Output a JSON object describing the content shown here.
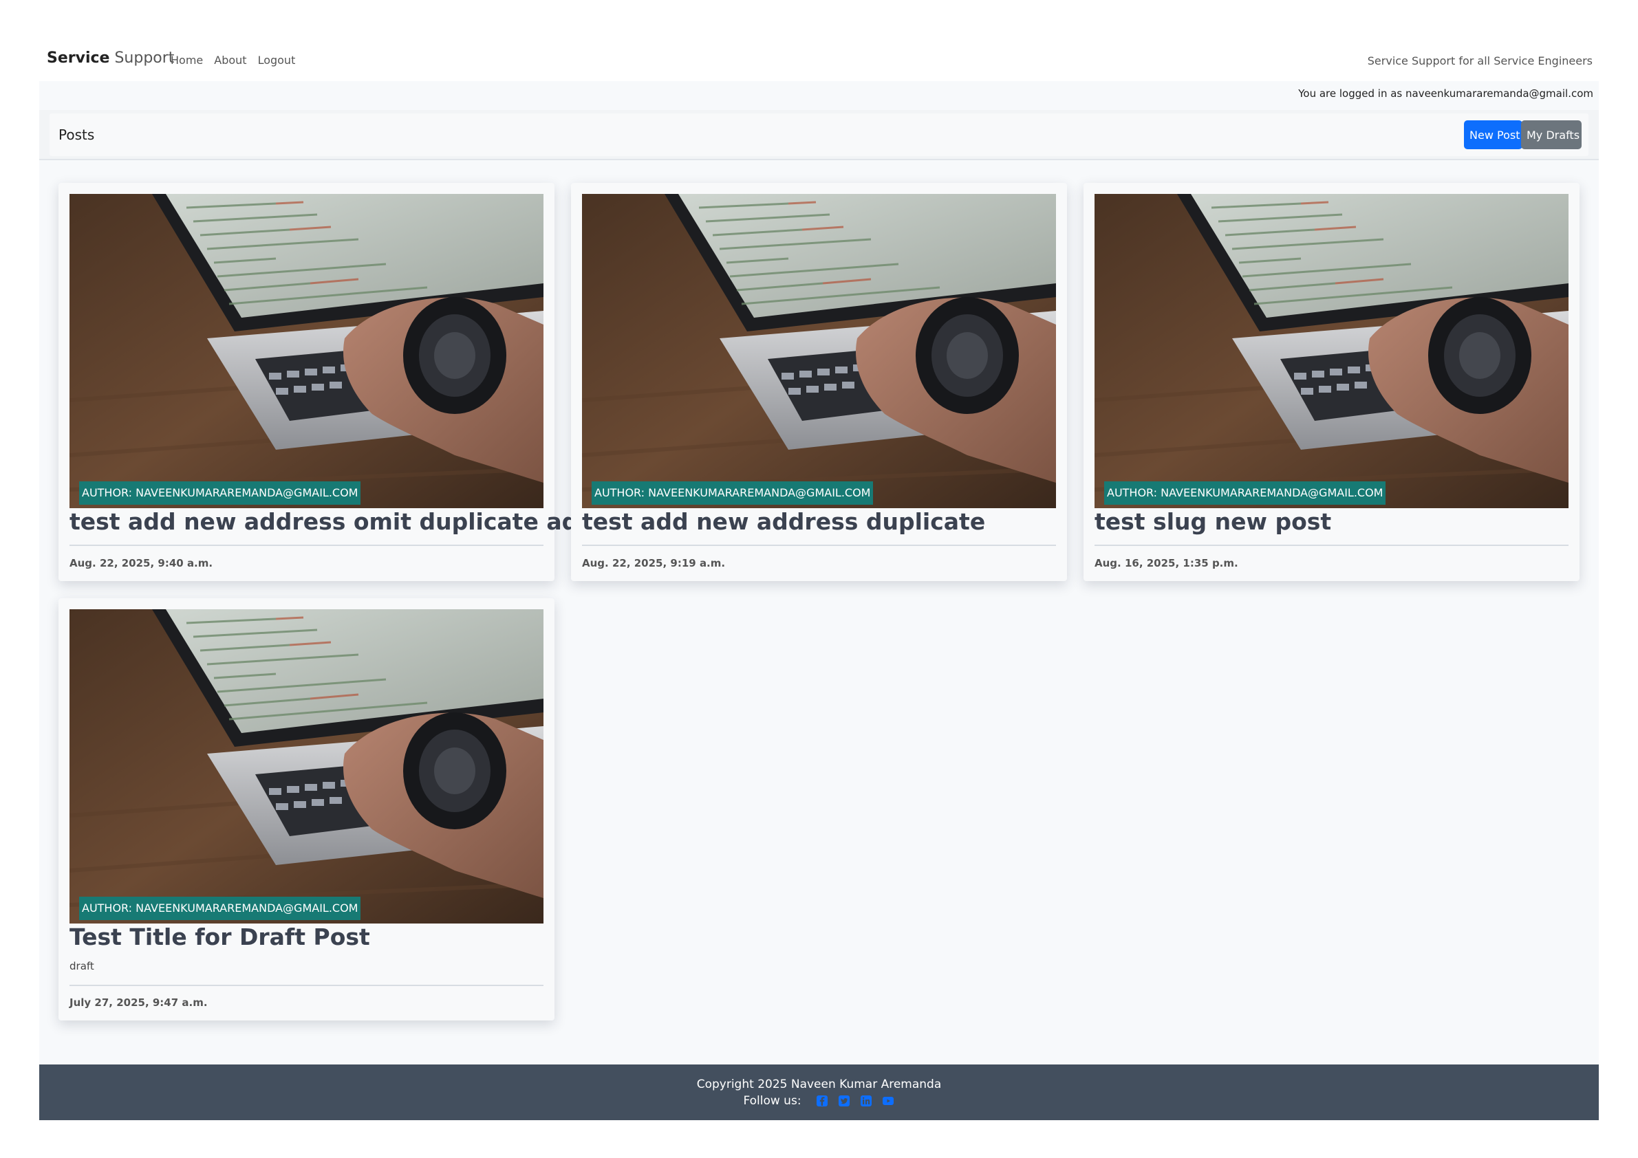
{
  "navbar": {
    "brand_bold": "Service",
    "brand_light": "Support",
    "links": [
      "Home",
      "About",
      "Logout"
    ],
    "tagline": "Service Support for all Service Engineers"
  },
  "session": {
    "logged_in_text": "You are logged in as naveenkumararemanda@gmail.com"
  },
  "posts_header": {
    "title": "Posts",
    "new_post_label": "New Post",
    "my_drafts_label": "My Drafts"
  },
  "posts": [
    {
      "author": "AUTHOR: NAVEENKUMARAREMANDA@GMAIL.COM",
      "title": "test add new address omit duplicate address",
      "status": "",
      "date": "Aug. 22, 2025, 9:40 a.m."
    },
    {
      "author": "AUTHOR: NAVEENKUMARAREMANDA@GMAIL.COM",
      "title": "test add new address duplicate",
      "status": "",
      "date": "Aug. 22, 2025, 9:19 a.m."
    },
    {
      "author": "AUTHOR: NAVEENKUMARAREMANDA@GMAIL.COM",
      "title": "test slug new post",
      "status": "",
      "date": "Aug. 16, 2025, 1:35 p.m."
    },
    {
      "author": "AUTHOR: NAVEENKUMARAREMANDA@GMAIL.COM",
      "title": "Test Title for Draft Post",
      "status": "draft",
      "date": "July 27, 2025, 9:47 a.m."
    }
  ],
  "footer": {
    "copyright": "Copyright 2025 Naveen Kumar Aremanda",
    "follow_label": "Follow us:",
    "social_icons": [
      "facebook-icon",
      "twitter-icon",
      "linkedin-icon",
      "youtube-icon"
    ]
  },
  "colors": {
    "primary": "#0d6efd",
    "secondary": "#6c757d",
    "author_badge": "#177a74",
    "footer_bg": "#434f5e",
    "page_bg": "#f7f9fb",
    "social_icon": "#0d6efd"
  }
}
